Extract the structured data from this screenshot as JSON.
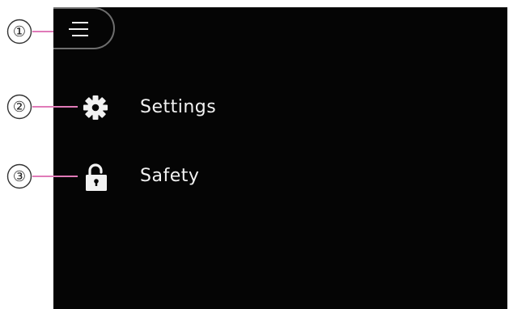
{
  "callouts": [
    "①",
    "②",
    "③"
  ],
  "menu": {
    "button_icon": "hamburger-icon",
    "items": [
      {
        "label": "Settings",
        "icon": "gear-icon"
      },
      {
        "label": "Safety",
        "icon": "padlock-icon"
      }
    ]
  },
  "colors": {
    "screen_background": "#050505",
    "text": "#f2f2f2",
    "leader_line": "#e07ab8",
    "button_border": "#6e6e6e"
  }
}
